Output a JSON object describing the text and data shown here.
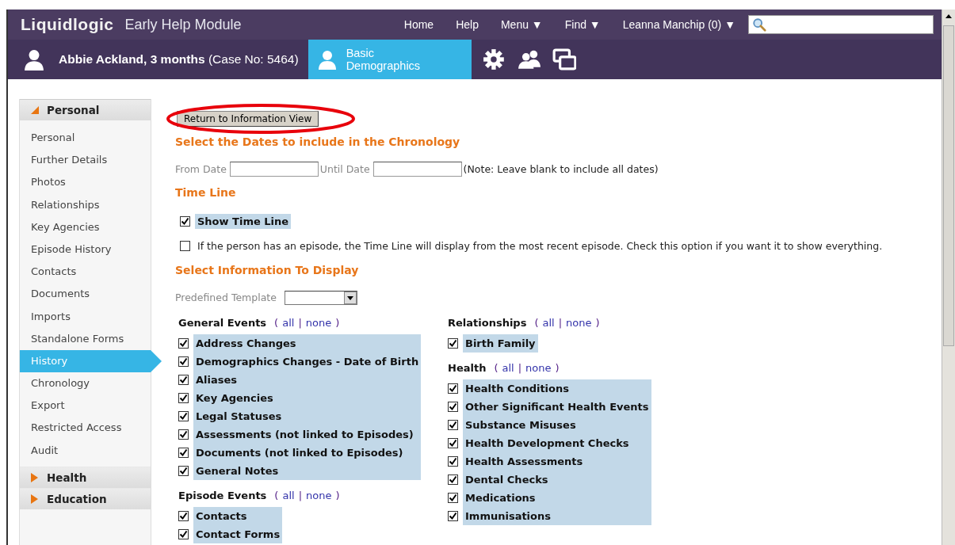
{
  "app": {
    "logo": "Liquidlogic",
    "module": "Early Help Module"
  },
  "nav": [
    {
      "label": "Home"
    },
    {
      "label": "Help"
    },
    {
      "label": "Menu ▼"
    },
    {
      "label": "Find ▼"
    },
    {
      "label": "Leanna Manchip (0) ▼"
    }
  ],
  "case_header": {
    "name": "Abbie Ackland, 3 months",
    "case_no": "(Case No: 5464)"
  },
  "case_tabs": [
    {
      "label": "Basic Demographics",
      "selected": true
    }
  ],
  "toolbar_icons": [
    {
      "kind": "gear"
    },
    {
      "kind": "people"
    },
    {
      "kind": "windows"
    }
  ],
  "sidebar": {
    "sections": [
      {
        "label": "Personal",
        "expanded": true,
        "items": [
          {
            "label": "Personal",
            "selected": false
          },
          {
            "label": "Further Details",
            "selected": false
          },
          {
            "label": "Photos",
            "selected": false
          },
          {
            "label": "Relationships",
            "selected": false
          },
          {
            "label": "Key Agencies",
            "selected": false
          },
          {
            "label": "Episode History",
            "selected": false
          },
          {
            "label": "Contacts",
            "selected": false
          },
          {
            "label": "Documents",
            "selected": false
          },
          {
            "label": "Imports",
            "selected": false
          },
          {
            "label": "Standalone Forms",
            "selected": false
          },
          {
            "label": "History",
            "selected": true
          },
          {
            "label": "Chronology",
            "selected": false
          },
          {
            "label": "Export",
            "selected": false
          },
          {
            "label": "Restricted Access",
            "selected": false
          },
          {
            "label": "Audit",
            "selected": false
          }
        ]
      },
      {
        "label": "Health",
        "expanded": false
      },
      {
        "label": "Education",
        "expanded": false
      }
    ]
  },
  "return_button": "Return to Information View",
  "annotation": {
    "kind": "ellipse"
  },
  "dates": {
    "heading": "Select the Dates to include in the Chronology",
    "from_label": "From Date",
    "until_label": "Until Date",
    "note": "(Note: Leave blank to include all dates)"
  },
  "timeline": {
    "heading": "Time Line",
    "options": [
      {
        "label": "Show Time Line",
        "checked": true
      },
      {
        "label": "If the person has an episode, the Time Line will display from the most recent episode. Check this option if you want it to show everything.",
        "checked": false
      }
    ]
  },
  "info": {
    "heading": "Select Information To Display",
    "template_label": "Predefined Template",
    "columns": [
      [
        {
          "title": "General Events",
          "open": "(",
          "all": "all",
          "separator": "|",
          "none": "none",
          "close": ")",
          "items": [
            {
              "label": "Address Changes",
              "checked": true
            },
            {
              "label": "Demographics Changes - Date of Birth",
              "checked": true
            },
            {
              "label": "Aliases",
              "checked": true
            },
            {
              "label": "Key Agencies",
              "checked": true
            },
            {
              "label": "Legal Statuses",
              "checked": true
            },
            {
              "label": "Assessments (not linked to Episodes)",
              "checked": true
            },
            {
              "label": "Documents (not linked to Episodes)",
              "checked": true
            },
            {
              "label": "General Notes",
              "checked": true
            }
          ]
        },
        {
          "title": "Episode Events",
          "open": "(",
          "all": "all",
          "separator": "|",
          "none": "none",
          "close": ")",
          "items": [
            {
              "label": "Contacts",
              "checked": true
            },
            {
              "label": "Contact Forms",
              "checked": true
            }
          ]
        }
      ],
      [
        {
          "title": "Relationships",
          "open": "(",
          "all": "all",
          "separator": "|",
          "none": "none",
          "close": ")",
          "items": [
            {
              "label": "Birth Family",
              "checked": true
            }
          ]
        },
        {
          "title": "Health",
          "open": "(",
          "all": "all",
          "separator": "|",
          "none": "none",
          "close": ")",
          "items": [
            {
              "label": "Health Conditions",
              "checked": true
            },
            {
              "label": "Other Significant Health Events",
              "checked": true
            },
            {
              "label": "Substance Misuses",
              "checked": true
            },
            {
              "label": "Health Development Checks",
              "checked": true
            },
            {
              "label": "Health Assessments",
              "checked": true
            },
            {
              "label": "Dental Checks",
              "checked": true
            },
            {
              "label": "Medications",
              "checked": true
            },
            {
              "label": "Immunisations",
              "checked": true
            }
          ]
        }
      ]
    ]
  }
}
